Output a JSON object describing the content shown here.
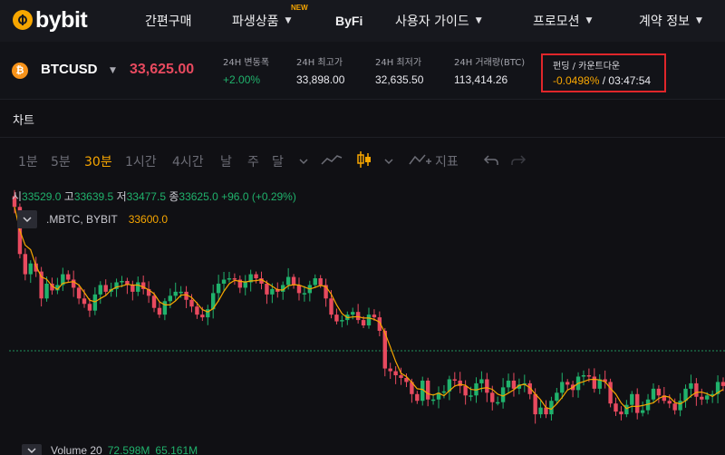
{
  "brand": {
    "name": "bybit",
    "accent": "#f7a600"
  },
  "nav": {
    "items": [
      {
        "label": "간편구매"
      },
      {
        "label": "파생상품",
        "badge": "NEW",
        "has_dropdown": true
      },
      {
        "label": "ByFi"
      },
      {
        "label": "사용자 가이드",
        "has_dropdown": true
      },
      {
        "label": "프로모션",
        "has_dropdown": true
      },
      {
        "label": "계약 정보",
        "has_dropdown": true
      }
    ]
  },
  "ticker": {
    "coin_icon": "bitcoin-icon",
    "coin_glyph": "₿",
    "symbol": "BTCUSD",
    "last_price": "33,625.00",
    "stats": [
      {
        "label": "24H 변동폭",
        "value": "+2.00%"
      },
      {
        "label": "24H 최고가",
        "value": "33,898.00"
      },
      {
        "label": "24H 최저가",
        "value": "32,635.50"
      },
      {
        "label": "24H 거래량(BTC)",
        "value": "113,414.26"
      }
    ],
    "funding": {
      "label": "펀딩 / 카운트다운",
      "rate": "-0.0498%",
      "separator": " / ",
      "countdown": "03:47:54"
    }
  },
  "chart": {
    "title": "차트",
    "timeframes": [
      "1분",
      "5분",
      "30분",
      "1시간",
      "4시간",
      "날",
      "주",
      "달"
    ],
    "active_timeframe": "30분",
    "indicator_label": "지표",
    "ohlc": {
      "open_label": "시",
      "open": "33529.0",
      "high_label": "고",
      "high": "33639.5",
      "low_label": "저",
      "low": "33477.5",
      "close_label": "종",
      "close": "33625.0",
      "change": "+96.0 (+0.29%)"
    },
    "overlay": {
      "name": ".MBTC, BYBIT",
      "value": "33600.0"
    },
    "volume": {
      "name": "Volume 20",
      "value1": "72.598M",
      "value2": "65.161M"
    },
    "colors": {
      "up": "#20b26c",
      "down": "#e84a5f",
      "ma": "#f7a600",
      "reference_line": "#1e8f5a"
    }
  },
  "chart_data": {
    "type": "line",
    "title": "",
    "xlabel": "",
    "ylabel": "",
    "grid": false,
    "series": [
      {
        "values": [
          33540,
          33505,
          33490,
          33498,
          33492,
          33472,
          33483,
          33478,
          33482,
          33490,
          33486,
          33480,
          33472,
          33468,
          33463,
          33475,
          33482,
          33477,
          33479,
          33484,
          33485,
          33482,
          33477,
          33484,
          33479,
          33474,
          33465,
          33460,
          33470,
          33474,
          33477,
          33477,
          33471,
          33466,
          33460,
          33458,
          33464,
          33476,
          33483,
          33486,
          33487,
          33486,
          33480,
          33484,
          33490,
          33487,
          33483,
          33475,
          33479,
          33477,
          33482,
          33488,
          33482,
          33476,
          33476,
          33482,
          33487,
          33482,
          33472,
          33460,
          33455,
          33456,
          33460,
          33462,
          33456,
          33452,
          33460,
          33458,
          33448,
          33420,
          33418,
          33415,
          33413,
          33410,
          33401,
          33396,
          33411,
          33397,
          33397,
          33402,
          33403,
          33412,
          33411,
          33407,
          33400,
          33400,
          33409,
          33412,
          33402,
          33395,
          33395,
          33406,
          33411,
          33405,
          33408,
          33409,
          33401,
          33386,
          33391,
          33386,
          33396,
          33402,
          33410,
          33408,
          33404,
          33414,
          33415,
          33414,
          33405,
          33412,
          33410,
          33394,
          33388,
          33386,
          33393,
          33401,
          33387,
          33389,
          33397,
          33405,
          33400,
          33396,
          33394,
          33389,
          33396,
          33405,
          33409,
          33399,
          33397,
          33400,
          33401,
          33410,
          33407
        ]
      }
    ],
    "reference_line": "",
    "volume_values": [
      72.598
    ]
  }
}
